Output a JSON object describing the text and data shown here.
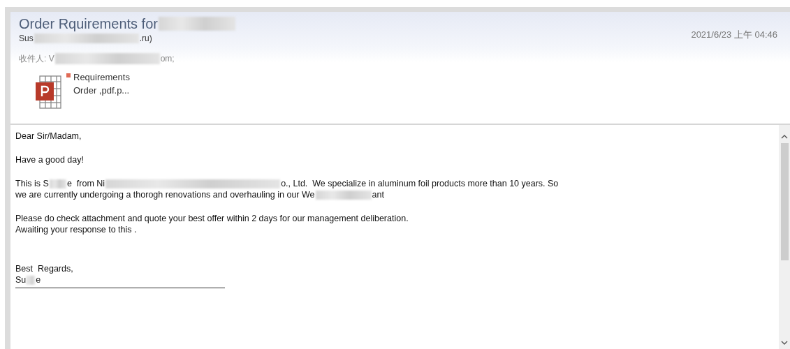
{
  "header": {
    "subject": [
      {
        "kind": "text",
        "text": "Order Rquirements for"
      },
      {
        "kind": "blur"
      }
    ],
    "sender": [
      {
        "kind": "text",
        "text": "Sus"
      },
      {
        "kind": "blur"
      },
      {
        "kind": "text",
        "text": ".ru)"
      }
    ],
    "date": "2021/6/23 上午 04:46",
    "to": [
      {
        "kind": "text",
        "text": "收件人: V"
      },
      {
        "kind": "blur"
      },
      {
        "kind": "text",
        "text": "om;"
      }
    ],
    "attachment": {
      "name_lines": [
        "Requirements",
        "Order ,pdf.p..."
      ]
    }
  },
  "body": {
    "paragraphs": [
      [
        [
          {
            "kind": "text",
            "text": "Dear Sir/Madam,"
          }
        ]
      ],
      [
        [
          {
            "kind": "text",
            "text": "Have a good day!"
          }
        ]
      ],
      [
        [
          {
            "kind": "text",
            "text": "This is S"
          },
          {
            "kind": "blur"
          },
          {
            "kind": "text",
            "text": "e  from Ni"
          },
          {
            "kind": "blur"
          },
          {
            "kind": "text",
            "text": "o., Ltd.  We specialize in aluminum foil products more than 10 years. So"
          }
        ],
        [
          {
            "kind": "text",
            "text": "we are currently undergoing a thorogh renovations and overhauling in our We"
          },
          {
            "kind": "blur"
          },
          {
            "kind": "text",
            "text": "ant"
          }
        ]
      ],
      [
        [
          {
            "kind": "text",
            "text": "Please do check attachment and quote your best offer within 2 days for our management deliberation."
          }
        ],
        [
          {
            "kind": "text",
            "text": "Awaiting your response to this ."
          }
        ]
      ],
      [
        [
          {
            "kind": "text",
            "text": "Best  Regards,"
          }
        ],
        [
          {
            "kind": "text",
            "text": "Su"
          },
          {
            "kind": "blur"
          },
          {
            "kind": "text",
            "text": "e"
          }
        ]
      ]
    ]
  }
}
